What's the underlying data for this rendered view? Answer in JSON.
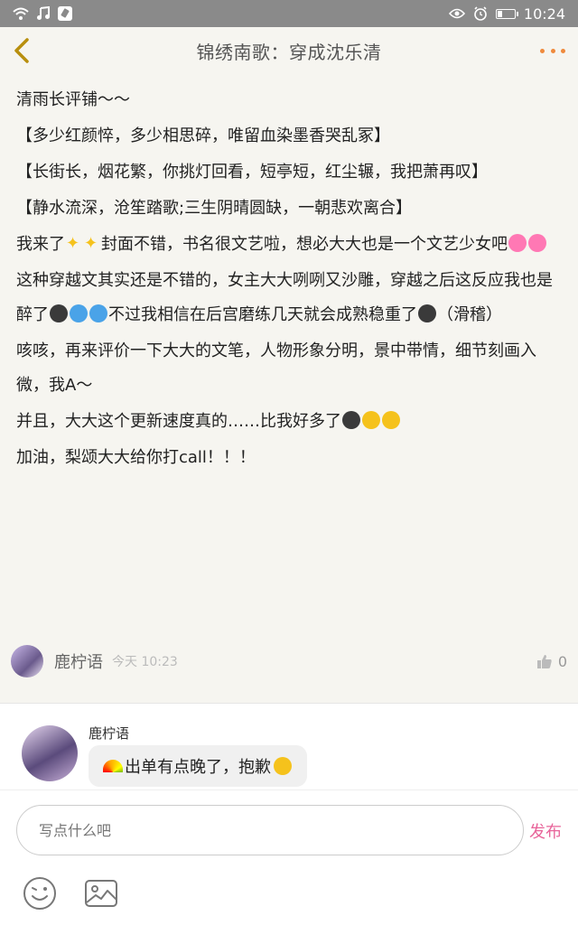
{
  "status_bar": {
    "time": "10:24",
    "icons": [
      "wifi-icon",
      "music-icon",
      "pin-icon",
      "eye-icon",
      "alarm-icon",
      "battery-icon"
    ],
    "battery_level": 0.25
  },
  "header": {
    "title": "锦绣南歌：穿成沈乐清",
    "back_icon": "chevron-left-icon",
    "more_icon": "more-dots-icon",
    "accent": "#ef8a3c"
  },
  "article": {
    "paragraphs": [
      {
        "text": "清雨长评铺～～"
      },
      {
        "text": "【多少红颜悴，多少相思碎，唯留血染墨香哭乱冢】"
      },
      {
        "text": "【长街长，烟花繁，你挑灯回看，短亭短，红尘辗，我把萧再叹】"
      },
      {
        "text": "【静水流深，沧笙踏歌;三生阴晴圆缺，一朝悲欢离合】"
      },
      {
        "a": "我来了",
        "b": "封面不错，书名很文艺啦，想必大大也是一个文艺少女吧"
      },
      {
        "a": "这种穿越文其实还是不错的，女主大大咧咧又沙雕，穿越之后这反应我也是醉了",
        "b": "不过我相信在后宫磨练几天就会成熟稳重了",
        "c": "（滑稽）"
      },
      {
        "text": "咳咳，再来评价一下大大的文笔，人物形象分明，景中带情，细节刻画入微，我A～"
      },
      {
        "a": "并且，大大这个更新速度真的……比我好多了"
      },
      {
        "text": "加油，梨颂大大给你打call！！！"
      }
    ],
    "author": {
      "name": "鹿柠语",
      "time": "今天 10:23",
      "likes": "0"
    }
  },
  "comment": {
    "name": "鹿柠语",
    "text": "出单有点晚了，抱歉"
  },
  "input": {
    "placeholder": "写点什么吧",
    "send_label": "发布",
    "send_color": "#e8649a"
  },
  "toolbar": {
    "icons": [
      "emoji-icon",
      "image-icon"
    ]
  }
}
